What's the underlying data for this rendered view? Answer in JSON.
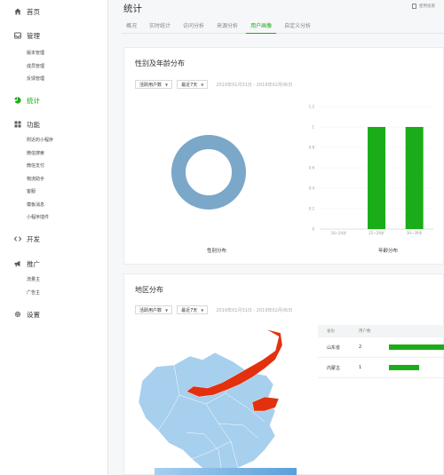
{
  "sidebar": {
    "home": "首页",
    "manage": {
      "label": "管理",
      "items": [
        "版本管理",
        "成员管理",
        "反馈管理"
      ]
    },
    "stats": "统计",
    "features": {
      "label": "功能",
      "items": [
        "附近的小程序",
        "微信搜索",
        "微信支付",
        "物流助手",
        "客服",
        "模板消息",
        "小程序插件"
      ]
    },
    "dev": "开发",
    "promo": {
      "label": "推广",
      "items": [
        "流量主",
        "广告主"
      ]
    },
    "settings": "设置"
  },
  "header": {
    "title": "统计",
    "help": "使用指南"
  },
  "tabs": [
    "概况",
    "实时统计",
    "访问分析",
    "来源分析",
    "用户画像",
    "自定义分析"
  ],
  "active_tab": "用户画像",
  "gender_age": {
    "title": "性别及年龄分布",
    "user_select": "活跃用户数",
    "period_select": "最近7天",
    "date_range": "2019年01月31日 - 2019年02月06日",
    "gender_caption": "性别分布",
    "age_caption": "年龄分布"
  },
  "region": {
    "title": "地区分布",
    "user_select": "活跃用户数",
    "period_select": "最近7天",
    "date_range": "2019年01月31日 - 2019年02月06日",
    "table_headers": [
      "省份",
      "用户数",
      ""
    ],
    "rows": [
      {
        "province": "山东省",
        "count": "2",
        "fraction": 1.0
      },
      {
        "province": "内蒙古",
        "count": "1",
        "fraction": 0.5
      }
    ]
  },
  "chart_data": [
    {
      "type": "pie",
      "title": "",
      "labels": [
        ""
      ],
      "values": [
        1
      ],
      "colors": [
        "#7ba7c9"
      ]
    },
    {
      "type": "bar",
      "title": "",
      "categories": [
        "18~24岁",
        "25~29岁",
        "30~39岁"
      ],
      "values": [
        0,
        1,
        1
      ],
      "ylim": [
        0,
        1.2
      ],
      "yticks": [
        "0",
        "0.2",
        "0.4",
        "0.6",
        "0.8",
        "1",
        "1.2"
      ],
      "colors": [
        "#1aad19"
      ]
    }
  ],
  "colors": {
    "accent": "#1aad19",
    "map_base": "#a7cfee",
    "map_highlight": "#e3310f"
  }
}
